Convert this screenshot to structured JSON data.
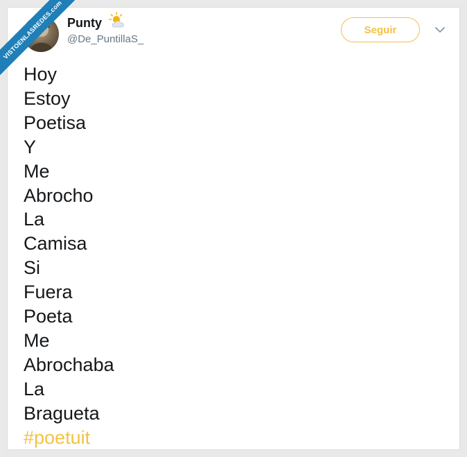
{
  "user": {
    "name": "Punty",
    "handle": "@De_PuntillaS_",
    "weather_icon": "sun-behind-cloud-icon"
  },
  "follow_label": "Seguir",
  "tweet": {
    "lines": [
      "Hoy",
      "Estoy",
      "Poetisa",
      "Y",
      "Me",
      "Abrocho",
      "La",
      "Camisa",
      "Si",
      "Fuera",
      "Poeta",
      "Me",
      "Abrochaba",
      "La",
      "Bragueta"
    ],
    "hashtag": "#poetuit"
  },
  "watermark": "VISTOENLASREDES.com",
  "colors": {
    "accent": "#f4c244",
    "text": "#14171a",
    "secondary": "#657786",
    "watermark": "#1f7fb8"
  }
}
